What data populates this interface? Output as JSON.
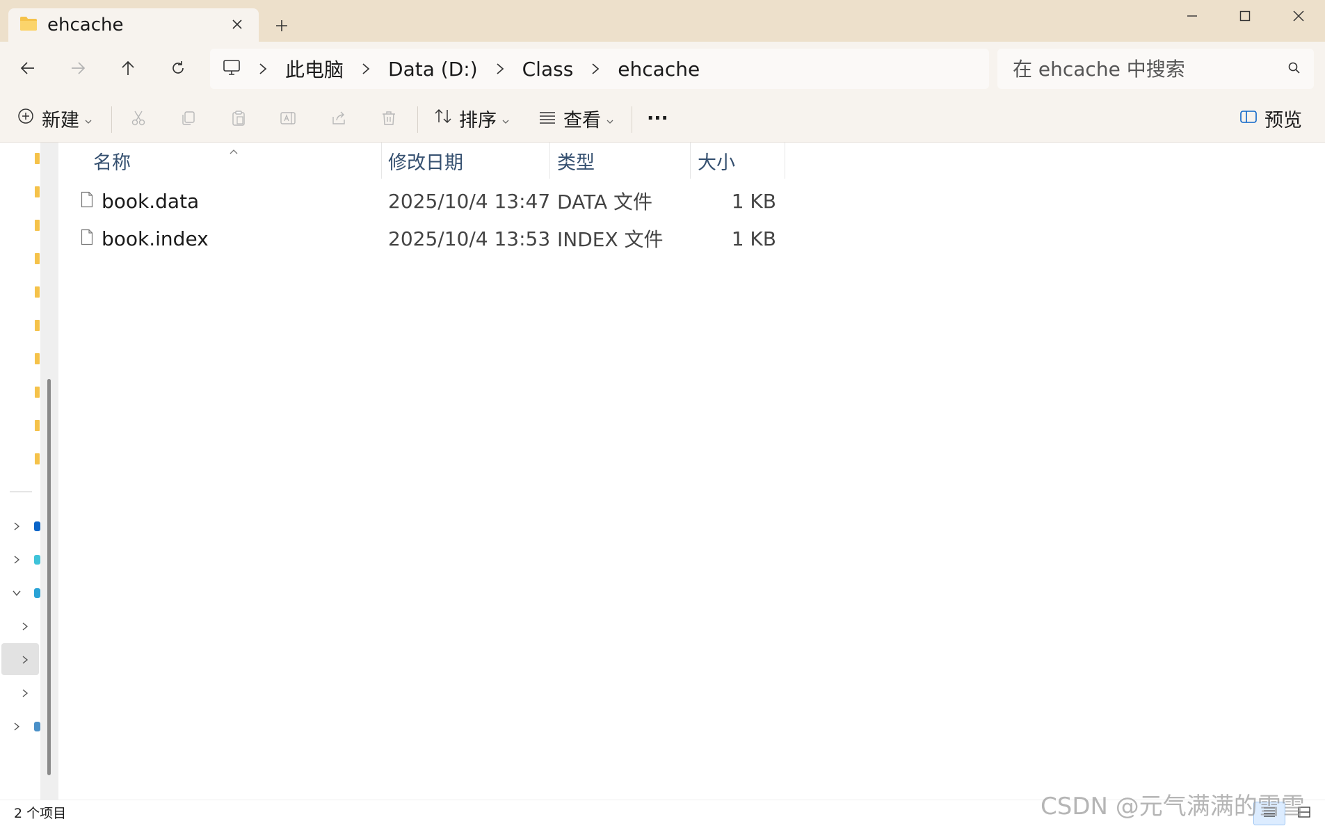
{
  "window": {
    "tab_title": "ehcache",
    "new_tab_label": "+"
  },
  "address": {
    "crumbs": [
      "此电脑",
      "Data (D:)",
      "Class",
      "ehcache"
    ]
  },
  "search": {
    "placeholder": "在 ehcache 中搜索"
  },
  "toolbar": {
    "new_label": "新建",
    "sort_label": "排序",
    "view_label": "查看",
    "more_label": "···",
    "preview_label": "预览"
  },
  "list": {
    "columns": [
      "名称",
      "修改日期",
      "类型",
      "大小"
    ],
    "rows": [
      {
        "name": "book.data",
        "date": "2025/10/4 13:47",
        "type": "DATA 文件",
        "size": "1 KB"
      },
      {
        "name": "book.index",
        "date": "2025/10/4 13:53",
        "type": "INDEX 文件",
        "size": "1 KB"
      }
    ]
  },
  "status": {
    "item_count": "2 个项目"
  },
  "watermark": "CSDN @元气满满的雪雪",
  "colors": {
    "titlebar_bg": "#ede0cb",
    "toolbar_bg": "#f7f3ee",
    "folder_yellow": "#f5c24a",
    "header_text": "#355070",
    "accent_blue": "#0a64c8"
  },
  "icons": {
    "tab": "folder-icon",
    "nav": [
      "back-arrow-icon",
      "forward-arrow-icon",
      "up-arrow-icon",
      "refresh-icon"
    ],
    "toolbar": [
      "cut-icon",
      "copy-icon",
      "paste-icon",
      "rename-icon",
      "share-icon",
      "delete-icon"
    ]
  }
}
